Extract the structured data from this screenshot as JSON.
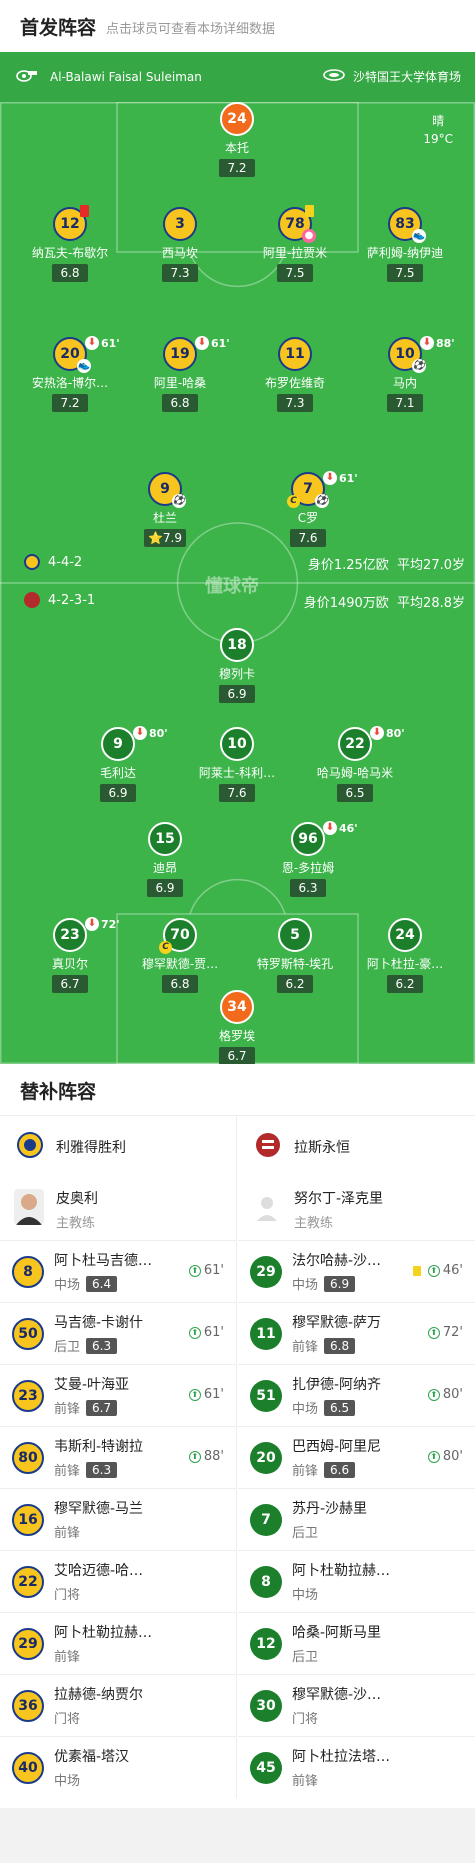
{
  "header": {
    "title": "首发阵容",
    "subtitle": "点击球员可查看本场详细数据"
  },
  "match": {
    "referee": "Al-Balawi Faisal Suleiman",
    "venue": "沙特国王大学体育场",
    "weather": "晴",
    "temperature": "19°C"
  },
  "home": {
    "formation": "4-4-2",
    "value": "身价1.25亿欧",
    "avg_age": "平均27.0岁"
  },
  "away": {
    "formation": "4-2-3-1",
    "value": "身价1490万欧",
    "avg_age": "平均28.8岁"
  },
  "watermark": "懂球帝",
  "home_players": [
    {
      "num": "24",
      "name": "本托",
      "rating": "7.2"
    },
    {
      "num": "12",
      "name": "纳瓦夫-布歇尔",
      "rating": "6.8"
    },
    {
      "num": "3",
      "name": "西马坎",
      "rating": "7.3"
    },
    {
      "num": "78",
      "name": "阿里-拉贾米",
      "rating": "7.5"
    },
    {
      "num": "83",
      "name": "萨利姆-纳伊迪",
      "rating": "7.5"
    },
    {
      "num": "20",
      "name": "安热洛-博尔…",
      "rating": "7.2",
      "sub": "61'"
    },
    {
      "num": "19",
      "name": "阿里-哈桑",
      "rating": "6.8",
      "sub": "61'"
    },
    {
      "num": "11",
      "name": "布罗佐维奇",
      "rating": "7.3"
    },
    {
      "num": "10",
      "name": "马内",
      "rating": "7.1",
      "sub": "88'"
    },
    {
      "num": "9",
      "name": "杜兰",
      "rating": "7.9"
    },
    {
      "num": "7",
      "name": "C罗",
      "rating": "7.6",
      "sub": "61'"
    }
  ],
  "away_players": [
    {
      "num": "18",
      "name": "穆列卡",
      "rating": "6.9"
    },
    {
      "num": "9",
      "name": "毛利达",
      "rating": "6.9",
      "sub": "80'"
    },
    {
      "num": "10",
      "name": "阿莱士-科利…",
      "rating": "7.6"
    },
    {
      "num": "22",
      "name": "哈马姆-哈马米",
      "rating": "6.5",
      "sub": "80'"
    },
    {
      "num": "15",
      "name": "迪昂",
      "rating": "6.9"
    },
    {
      "num": "96",
      "name": "恩-多拉姆",
      "rating": "6.3",
      "sub": "46'"
    },
    {
      "num": "23",
      "name": "真贝尔",
      "rating": "6.7",
      "sub": "72'"
    },
    {
      "num": "70",
      "name": "穆罕默德-贾…",
      "rating": "6.8"
    },
    {
      "num": "5",
      "name": "特罗斯特-埃孔",
      "rating": "6.2"
    },
    {
      "num": "24",
      "name": "阿卜杜拉-豪…",
      "rating": "6.2"
    },
    {
      "num": "34",
      "name": "格罗埃",
      "rating": "6.7"
    }
  ],
  "subs": {
    "title": "替补阵容",
    "home_team": "利雅得胜利",
    "away_team": "拉斯永恒",
    "home_coach": {
      "name": "皮奥利",
      "role": "主教练"
    },
    "away_coach": {
      "name": "努尔丁-泽克里",
      "role": "主教练"
    },
    "home_list": [
      {
        "num": "8",
        "name": "阿卜杜马吉德…",
        "pos": "中场",
        "rating": "6.4",
        "in": "61'"
      },
      {
        "num": "50",
        "name": "马吉德-卡谢什",
        "pos": "后卫",
        "rating": "6.3",
        "in": "61'"
      },
      {
        "num": "23",
        "name": "艾曼-叶海亚",
        "pos": "前锋",
        "rating": "6.7",
        "in": "61'"
      },
      {
        "num": "80",
        "name": "韦斯利-特谢拉",
        "pos": "前锋",
        "rating": "6.3",
        "in": "88'"
      },
      {
        "num": "16",
        "name": "穆罕默德-马兰",
        "pos": "前锋"
      },
      {
        "num": "22",
        "name": "艾哈迈德-哈…",
        "pos": "门将"
      },
      {
        "num": "29",
        "name": "阿卜杜勒拉赫…",
        "pos": "前锋"
      },
      {
        "num": "36",
        "name": "拉赫德-纳贾尔",
        "pos": "门将"
      },
      {
        "num": "40",
        "name": "优素福-塔汉",
        "pos": "中场"
      }
    ],
    "away_list": [
      {
        "num": "29",
        "name": "法尔哈赫-沙…",
        "pos": "中场",
        "rating": "6.9",
        "in": "46'",
        "card": "yellow"
      },
      {
        "num": "11",
        "name": "穆罕默德-萨万",
        "pos": "前锋",
        "rating": "6.8",
        "in": "72'"
      },
      {
        "num": "51",
        "name": "扎伊德-阿纳齐",
        "pos": "中场",
        "rating": "6.5",
        "in": "80'"
      },
      {
        "num": "20",
        "name": "巴西姆-阿里尼",
        "pos": "前锋",
        "rating": "6.6",
        "in": "80'"
      },
      {
        "num": "7",
        "name": "苏丹-沙赫里",
        "pos": "后卫"
      },
      {
        "num": "8",
        "name": "阿卜杜勒拉赫…",
        "pos": "中场"
      },
      {
        "num": "12",
        "name": "哈桑-阿斯马里",
        "pos": "后卫"
      },
      {
        "num": "30",
        "name": "穆罕默德-沙…",
        "pos": "门将"
      },
      {
        "num": "45",
        "name": "阿卜杜拉法塔…",
        "pos": "前锋"
      }
    ]
  },
  "colors": {
    "pitch": "#3cb44a",
    "home_shirt": "#f7c51e",
    "away_shirt": "#1b7f2b",
    "gk": "#f26a1b"
  }
}
